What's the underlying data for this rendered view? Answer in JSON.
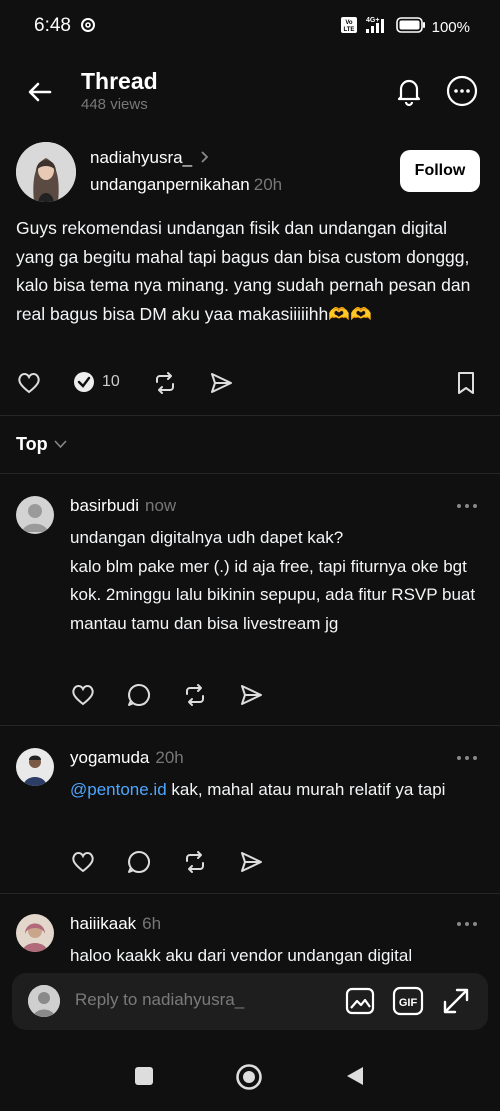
{
  "status_bar": {
    "time": "6:48",
    "network": "4G+",
    "volte": "Vo LTE",
    "battery": "100%"
  },
  "header": {
    "title": "Thread",
    "views": "448 views"
  },
  "post": {
    "author": "nadiahyusra_",
    "community": "undanganpernikahan",
    "time": "20h",
    "follow_label": "Follow",
    "body": "Guys rekomendasi undangan fisik dan undangan digital yang ga begitu mahal tapi bagus dan bisa custom donggg, kalo bisa tema nya minang. yang sudah pernah pesan dan real bagus bisa DM aku yaa makasiiiiihh🫶🫶",
    "reply_count": "10"
  },
  "filter": {
    "label": "Top"
  },
  "replies": [
    {
      "user": "basirbudi",
      "time": "now",
      "body": "undangan digitalnya udh dapet kak?\nkalo blm pake mer (.) id aja free, tapi fiturnya oke bgt kok. 2minggu lalu bikinin sepupu, ada fitur RSVP buat mantau tamu dan bisa livestream jg"
    },
    {
      "user": "yogamuda",
      "time": "20h",
      "mention": "@pentone.id",
      "body": " kak, mahal atau murah relatif ya tapi"
    },
    {
      "user": "haiiikaak",
      "time": "6h",
      "body": "haloo kaakk aku dari vendor undangan digital"
    }
  ],
  "reply_bar": {
    "placeholder": "Reply to nadiahyusra_",
    "gif_label": "GIF"
  },
  "colors": {
    "background": "#101010",
    "mention": "#4da6ff",
    "follow_bg": "#ffffff"
  }
}
